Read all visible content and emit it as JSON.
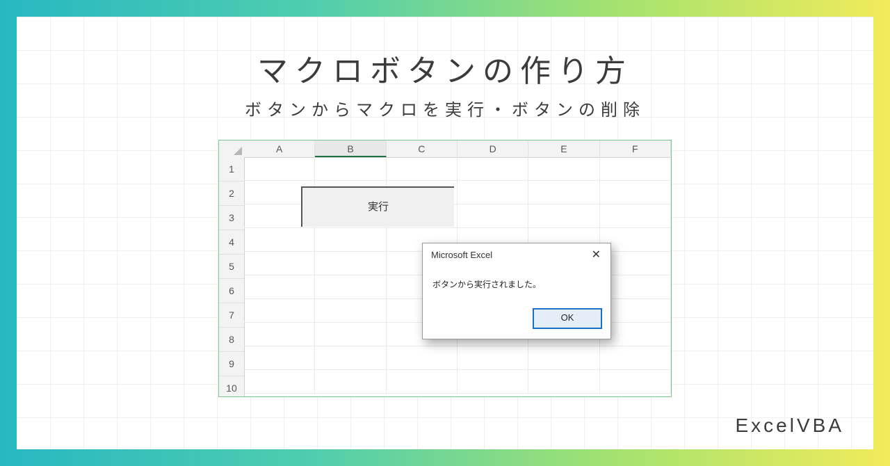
{
  "title": "マクロボタンの作り方",
  "subtitle": "ボタンからマクロを実行・ボタンの削除",
  "spreadsheet": {
    "columns": [
      "A",
      "B",
      "C",
      "D",
      "E",
      "F"
    ],
    "rows": [
      "1",
      "2",
      "3",
      "4",
      "5",
      "6",
      "7",
      "8",
      "9",
      "10"
    ],
    "selected_column": "B",
    "macro_button_label": "実行"
  },
  "dialog": {
    "title": "Microsoft Excel",
    "message": "ボタンから実行されました。",
    "ok_label": "OK",
    "close_glyph": "✕"
  },
  "brand": "ExcelVBA"
}
